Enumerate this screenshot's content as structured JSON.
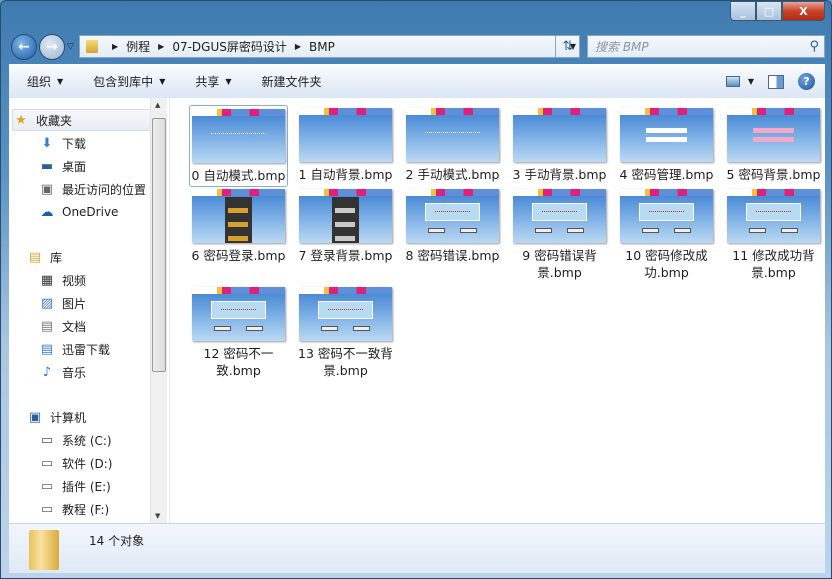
{
  "window": {
    "minimize": "_",
    "maximize": "□",
    "close": "X"
  },
  "address": {
    "crumbs": [
      "例程",
      "07-DGUS屏密码设计",
      "BMP"
    ]
  },
  "search": {
    "placeholder": "搜索 BMP"
  },
  "toolbar": {
    "organize": "组织",
    "include": "包含到库中",
    "share": "共享",
    "new_folder": "新建文件夹"
  },
  "sidebar": {
    "favorites": {
      "label": "收藏夹",
      "items": [
        "下载",
        "桌面",
        "最近访问的位置",
        "OneDrive"
      ]
    },
    "libraries": {
      "label": "库",
      "items": [
        "视频",
        "图片",
        "文档",
        "迅雷下载",
        "音乐"
      ]
    },
    "computer": {
      "label": "计算机",
      "items": [
        "系统 (C:)",
        "软件 (D:)",
        "插件 (E:)",
        "教程 (F:)"
      ]
    }
  },
  "files": [
    {
      "name": "0 自动模式.bmp",
      "kind": "text"
    },
    {
      "name": "1 自动背景.bmp",
      "kind": "plain"
    },
    {
      "name": "2 手动模式.bmp",
      "kind": "text"
    },
    {
      "name": "3 手动背景.bmp",
      "kind": "plain"
    },
    {
      "name": "4 密码管理.bmp",
      "kind": "fields"
    },
    {
      "name": "5 密码背景.bmp",
      "kind": "fields-pink"
    },
    {
      "name": "6 密码登录.bmp",
      "kind": "keypad-gold"
    },
    {
      "name": "7 登录背景.bmp",
      "kind": "keypad-gray"
    },
    {
      "name": "8 密码错误.bmp",
      "kind": "dialog"
    },
    {
      "name": "9 密码错误背景.bmp",
      "kind": "dialog"
    },
    {
      "name": "10 密码修改成功.bmp",
      "kind": "dialog"
    },
    {
      "name": "11 修改成功背景.bmp",
      "kind": "dialog"
    },
    {
      "name": "12 密码不一致.bmp",
      "kind": "dialog"
    },
    {
      "name": "13 密码不一致背景.bmp",
      "kind": "dialog"
    }
  ],
  "status": {
    "count": "14 个对象"
  }
}
